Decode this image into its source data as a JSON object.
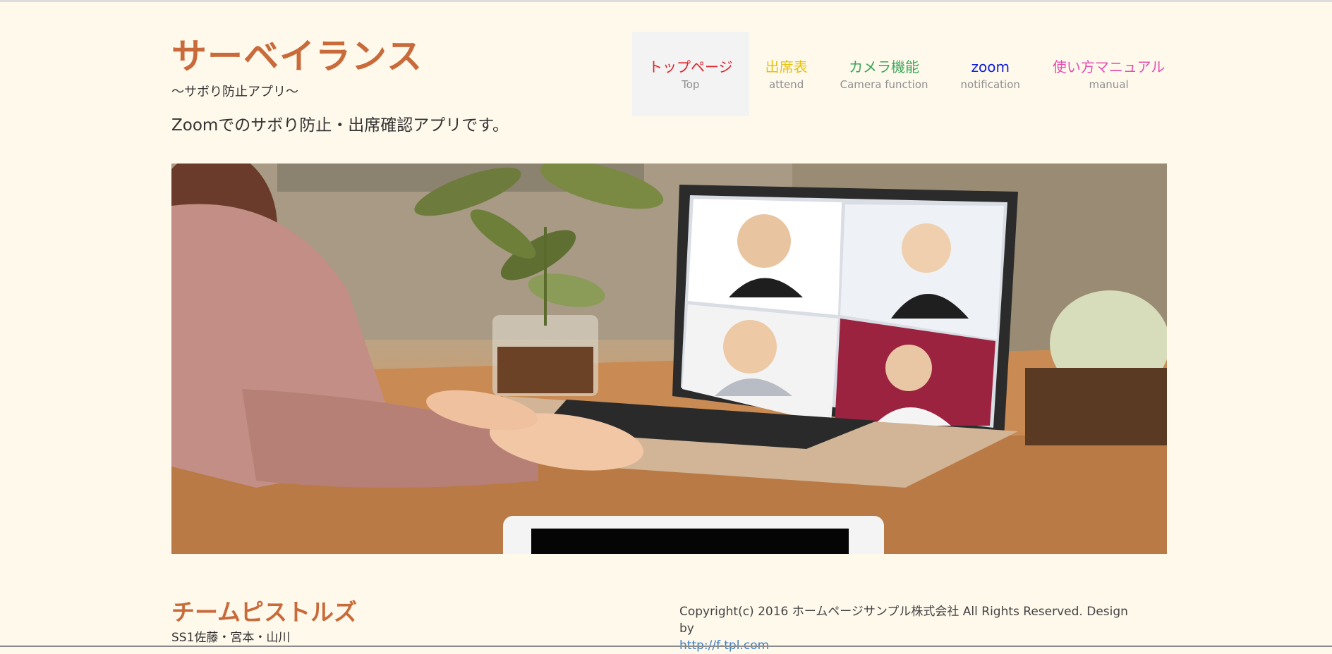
{
  "header": {
    "title": "サーベイランス",
    "subtitle": "～サボり防止アプリ～",
    "description": "Zoomでのサボり防止・出席確認アプリです。"
  },
  "nav": [
    {
      "label": "トップページ",
      "sub": "Top",
      "color": "#e0232d",
      "active": true
    },
    {
      "label": "出席表",
      "sub": "attend",
      "color": "#e6c213",
      "active": false
    },
    {
      "label": "カメラ機能",
      "sub": "Camera function",
      "color": "#3aa55a",
      "active": false
    },
    {
      "label": "zoom",
      "sub": "notification",
      "color": "#1020d8",
      "active": false
    },
    {
      "label": "使い方マニュアル",
      "sub": "manual",
      "color": "#e34fb4",
      "active": false
    }
  ],
  "hero": {
    "image_icon": "video-conference-photo-icon"
  },
  "footer": {
    "team_name": "チームピストルズ",
    "members": "SS1佐藤・宮本・山川",
    "copyright": "Copyright(c) 2016 ホームページサンプル株式会社 All Rights Reserved. Design by",
    "link_text": "http://f-tpl.com"
  }
}
